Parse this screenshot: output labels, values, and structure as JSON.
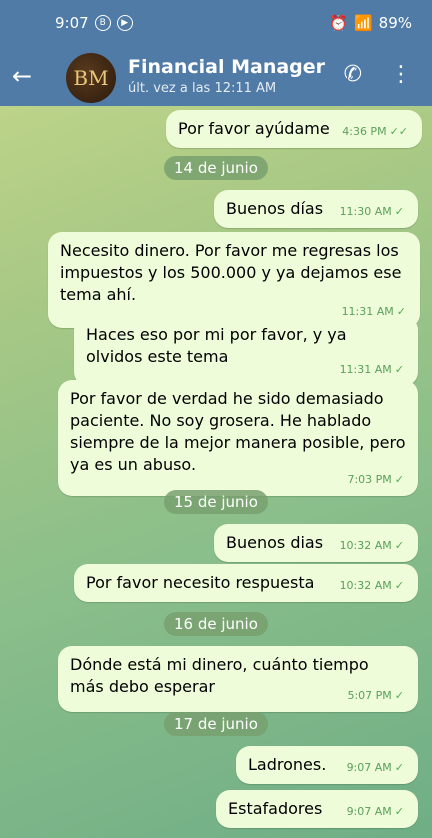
{
  "status": {
    "time": "9:07",
    "battery": "89%"
  },
  "header": {
    "avatar_text": "BM",
    "title": "Financial Manager (C",
    "subtitle": "últ. vez a las 12:11 AM"
  },
  "messages": [
    {
      "text": "Por favor ayúdame",
      "time": "4:36 PM",
      "check": "✓✓"
    },
    {
      "text": "Buenos días",
      "time": "11:30 AM",
      "check": "✓"
    },
    {
      "text": "Necesito dinero. Por favor me regresas los impuestos y los 500.000 y ya dejamos ese tema ahí.",
      "time": "11:31 AM",
      "check": "✓"
    },
    {
      "text": "Haces eso por mi por favor, y ya olvidos este tema",
      "time": "11:31 AM",
      "check": "✓"
    },
    {
      "text": "Por favor de verdad he sido demasiado paciente. No soy grosera. He hablado siempre de la mejor manera posible, pero ya es un abuso.",
      "time": "7:03 PM",
      "check": "✓"
    },
    {
      "text": "Buenos dias",
      "time": "10:32 AM",
      "check": "✓"
    },
    {
      "text": "Por favor necesito respuesta",
      "time": "10:32 AM",
      "check": "✓"
    },
    {
      "text": "Dónde está mi dinero, cuánto tiempo más debo esperar",
      "time": "5:07 PM",
      "check": "✓"
    },
    {
      "text": "Ladrones.",
      "time": "9:07 AM",
      "check": "✓"
    },
    {
      "text": "Estafadores",
      "time": "9:07 AM",
      "check": "✓"
    }
  ],
  "dates": [
    "14 de junio",
    "15 de junio",
    "16 de junio",
    "17 de junio"
  ]
}
